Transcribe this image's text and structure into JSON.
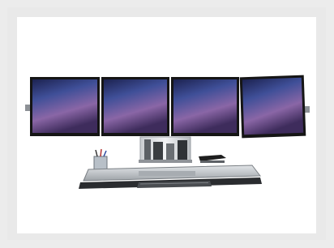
{
  "image": {
    "subject": "quad-monitor-workstation-photo",
    "monitor_count": 4,
    "screen_gradient": [
      "#1d2350",
      "#3d4c94",
      "#9a6aa6",
      "#4b3468"
    ],
    "bezel_color": "#1a1a1a",
    "desk_color": "#cfd3d6"
  }
}
